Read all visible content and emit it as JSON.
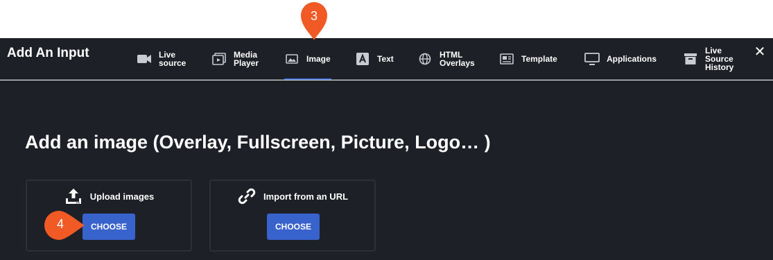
{
  "header": {
    "title": "Add An Input",
    "close_glyph": "✕"
  },
  "tabs": [
    {
      "label": "Live\nsource",
      "icon": "camera-icon"
    },
    {
      "label": "Media\nPlayer",
      "icon": "media-player-icon"
    },
    {
      "label": "Image",
      "icon": "image-icon",
      "active": true
    },
    {
      "label": "Text",
      "icon": "text-icon"
    },
    {
      "label": "HTML\nOverlays",
      "icon": "globe-icon"
    },
    {
      "label": "Template",
      "icon": "template-icon"
    },
    {
      "label": "Applications",
      "icon": "monitor-icon"
    },
    {
      "label": "Live\nSource\nHistory",
      "icon": "archive-icon"
    }
  ],
  "main": {
    "heading": "Add an image (Overlay, Fullscreen, Picture, Logo… )",
    "upload": {
      "label": "Upload images",
      "button": "CHOOSE",
      "icon": "upload-icon"
    },
    "url": {
      "label": "Import from an URL",
      "button": "CHOOSE",
      "icon": "link-icon"
    }
  },
  "annotations": [
    {
      "number": "3",
      "shape": "pin-down"
    },
    {
      "number": "4",
      "shape": "pointer-right"
    }
  ],
  "colors": {
    "background": "#1e2027",
    "accent": "#3862cc",
    "marker": "#f15a24"
  }
}
